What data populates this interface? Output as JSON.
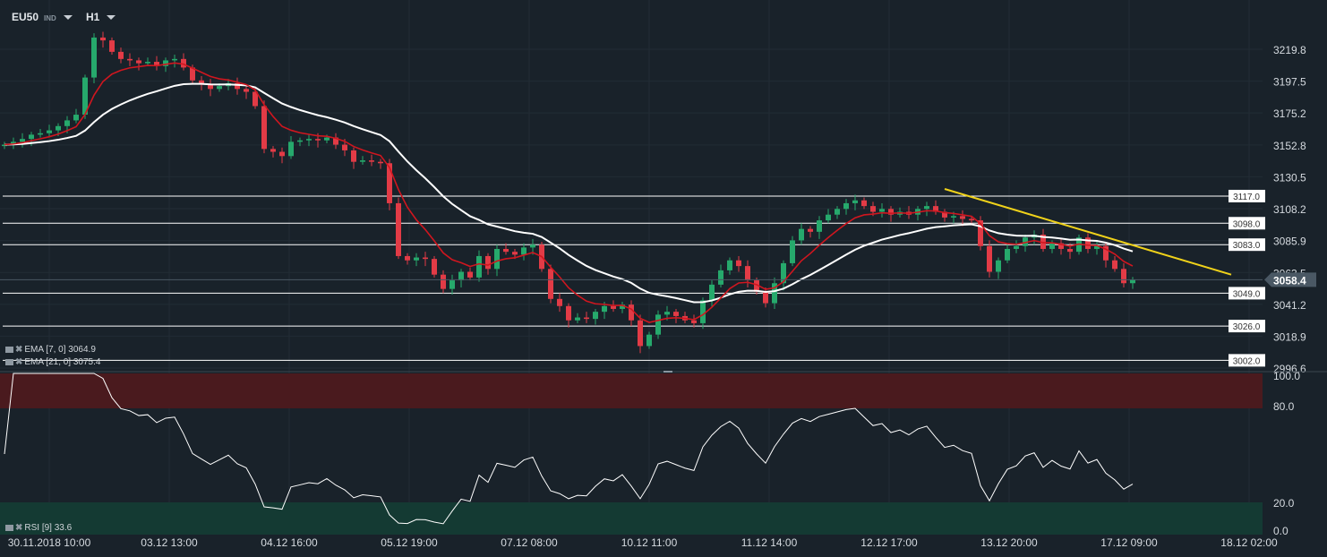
{
  "header": {
    "symbol": "EU50",
    "type": "IND",
    "timeframe": "H1"
  },
  "indicators": {
    "ema7": {
      "label": "EMA [7, 0] 3064.9",
      "period": 7,
      "color": "#d0161f"
    },
    "ema21": {
      "label": "EMA [21, 0] 3075.4",
      "period": 21,
      "color": "#ffffff"
    },
    "rsi": {
      "label": "RSI [9] 33.6",
      "period": 9,
      "overbought": 80,
      "oversold": 20
    }
  },
  "colors": {
    "background": "#19222a",
    "up": "#26a96c",
    "down": "#e23b46",
    "trendline": "#f0d21a",
    "overbought_zone": "#4a1a1e",
    "oversold_zone": "#143a33"
  },
  "chart_data": {
    "type": "candlestick",
    "price_axis": {
      "ticks": [
        3219.8,
        3197.5,
        3175.2,
        3152.8,
        3130.5,
        3108.2,
        3085.9,
        3063.5,
        3041.2,
        3018.9,
        2996.6
      ],
      "range": [
        2996.6,
        3219.8
      ]
    },
    "rsi_axis": {
      "ticks": [
        "100.0",
        "80.0",
        "20.0",
        "0.0"
      ],
      "range": [
        0,
        100
      ]
    },
    "time_labels": [
      "30.11.2018 10:00",
      "03.12 13:00",
      "04.12 16:00",
      "05.12 19:00",
      "07.12 08:00",
      "10.12 11:00",
      "11.12 14:00",
      "12.12 17:00",
      "13.12 20:00",
      "17.12 09:00",
      "18.12 02:00"
    ],
    "last_price": "3058.4",
    "closes": [
      3153,
      3155,
      3157,
      3160,
      3161,
      3163,
      3166,
      3170,
      3174,
      3200,
      3228,
      3226,
      3218,
      3213,
      3212,
      3210,
      3211,
      3208,
      3212,
      3213,
      3207,
      3198,
      3195,
      3192,
      3194,
      3196,
      3192,
      3190,
      3180,
      3150,
      3148,
      3145,
      3155,
      3156,
      3157,
      3156,
      3158,
      3153,
      3149,
      3141,
      3142,
      3141,
      3140,
      3112,
      3075,
      3072,
      3074,
      3073,
      3062,
      3052,
      3058,
      3064,
      3060,
      3075,
      3066,
      3080,
      3078,
      3076,
      3081,
      3083,
      3066,
      3045,
      3040,
      3030,
      3032,
      3031,
      3036,
      3040,
      3038,
      3041,
      3030,
      3012,
      3020,
      3034,
      3036,
      3033,
      3030,
      3028,
      3044,
      3055,
      3065,
      3072,
      3068,
      3058,
      3050,
      3042,
      3056,
      3070,
      3086,
      3094,
      3092,
      3100,
      3104,
      3108,
      3112,
      3114,
      3110,
      3106,
      3108,
      3104,
      3106,
      3104,
      3108,
      3110,
      3106,
      3102,
      3103,
      3101,
      3100,
      3082,
      3064,
      3072,
      3080,
      3082,
      3088,
      3090,
      3080,
      3084,
      3080,
      3078,
      3088,
      3080,
      3082,
      3072,
      3066,
      3056,
      3058.4
    ],
    "horizontal_levels": [
      "3117.0",
      "3098.0",
      "3083.0",
      "3049.0",
      "3026.0",
      "3002.0"
    ],
    "trendline": {
      "from": {
        "candle": 105,
        "price": 3122
      },
      "to": {
        "candle": 137,
        "price": 3062
      }
    }
  }
}
